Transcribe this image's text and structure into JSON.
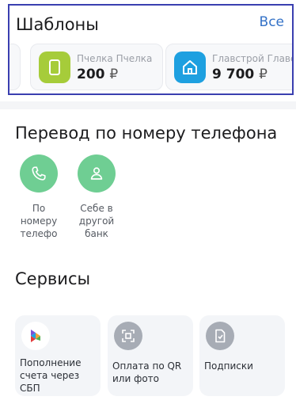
{
  "templates": {
    "title": "Шаблоны",
    "all_label": "Все",
    "items": [
      {
        "name": "Пчелка Пчелка",
        "amount": "200",
        "currency": "₽",
        "icon": "card-icon",
        "color": "#a6cc3a"
      },
      {
        "name": "Главстрой Главстрой",
        "amount": "9 700",
        "currency": "₽",
        "icon": "home-icon",
        "color": "#1ea0e0"
      }
    ]
  },
  "phone_transfer": {
    "title": "Перевод по номеру телефона",
    "items": [
      {
        "label_lines": [
          "По",
          "номеру",
          "телефо"
        ],
        "icon": "phone-icon"
      },
      {
        "label_lines": [
          "Себе в",
          "другой",
          "банк"
        ],
        "icon": "person-icon"
      }
    ]
  },
  "services": {
    "title": "Сервисы",
    "items": [
      {
        "label_lines": [
          "Пополнение",
          "счета через",
          "СБП"
        ],
        "icon": "sbp-icon"
      },
      {
        "label_lines": [
          "Оплата по QR",
          "или фото"
        ],
        "icon": "qr-scan-icon"
      },
      {
        "label_lines": [
          "Подписки"
        ],
        "icon": "subscription-icon"
      }
    ]
  },
  "colors": {
    "accent_link": "#3472c7",
    "phone_circle": "#6fce93",
    "highlight_border": "#3a3fb0"
  }
}
